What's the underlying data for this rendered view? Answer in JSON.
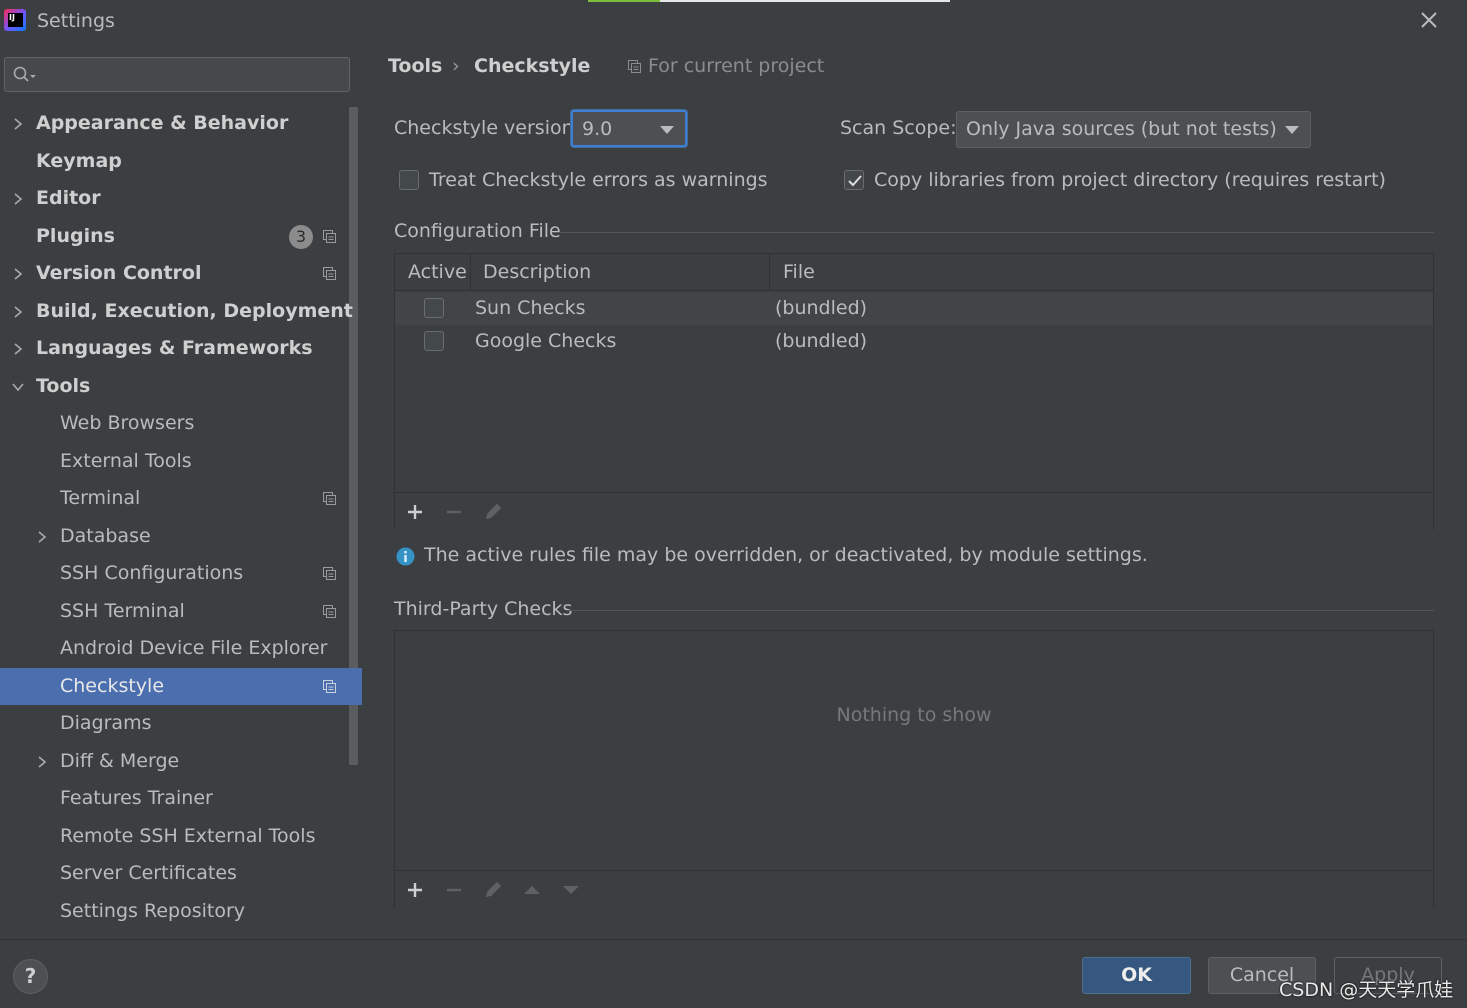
{
  "window": {
    "title": "Settings"
  },
  "search": {
    "placeholder": "",
    "value": ""
  },
  "sidebar": {
    "items": [
      {
        "label": "Appearance & Behavior"
      },
      {
        "label": "Keymap"
      },
      {
        "label": "Editor"
      },
      {
        "label": "Plugins",
        "badge": "3"
      },
      {
        "label": "Version Control"
      },
      {
        "label": "Build, Execution, Deployment"
      },
      {
        "label": "Languages & Frameworks"
      },
      {
        "label": "Tools"
      },
      {
        "label": "Web Browsers"
      },
      {
        "label": "External Tools"
      },
      {
        "label": "Terminal"
      },
      {
        "label": "Database"
      },
      {
        "label": "SSH Configurations"
      },
      {
        "label": "SSH Terminal"
      },
      {
        "label": "Android Device File Explorer"
      },
      {
        "label": "Checkstyle"
      },
      {
        "label": "Diagrams"
      },
      {
        "label": "Diff & Merge"
      },
      {
        "label": "Features Trainer"
      },
      {
        "label": "Remote SSH External Tools"
      },
      {
        "label": "Server Certificates"
      },
      {
        "label": "Settings Repository"
      }
    ]
  },
  "breadcrumb": {
    "parent": "Tools",
    "separator": "›",
    "current": "Checkstyle"
  },
  "scope_note": "For current project",
  "checkstyle": {
    "version_label": "Checkstyle version:",
    "version_value": "9.0",
    "scan_scope_label": "Scan Scope:",
    "scan_scope_value": "Only Java sources (but not tests)",
    "treat_errors_label": "Treat Checkstyle errors as warnings",
    "treat_errors_checked": false,
    "copy_libs_label": "Copy libraries from project directory (requires restart)",
    "copy_libs_checked": true
  },
  "config_file": {
    "title": "Configuration File",
    "columns": [
      "Active",
      "Description",
      "File"
    ],
    "rows": [
      {
        "active": false,
        "description": "Sun Checks",
        "file": "(bundled)"
      },
      {
        "active": false,
        "description": "Google Checks",
        "file": "(bundled)"
      }
    ],
    "info": "The active rules file may be overridden, or deactivated, by module settings."
  },
  "third_party": {
    "title": "Third-Party Checks",
    "empty_text": "Nothing to show"
  },
  "footer": {
    "help": "?",
    "ok": "OK",
    "cancel": "Cancel",
    "apply": "Apply"
  },
  "watermark": "CSDN @天天学爪娃",
  "colors": {
    "background": "#3c3f41",
    "selection": "#4b6eaf",
    "ok_button": "#365880",
    "focus_ring": "#3d7fd6",
    "info_icon": "#3592c4"
  }
}
